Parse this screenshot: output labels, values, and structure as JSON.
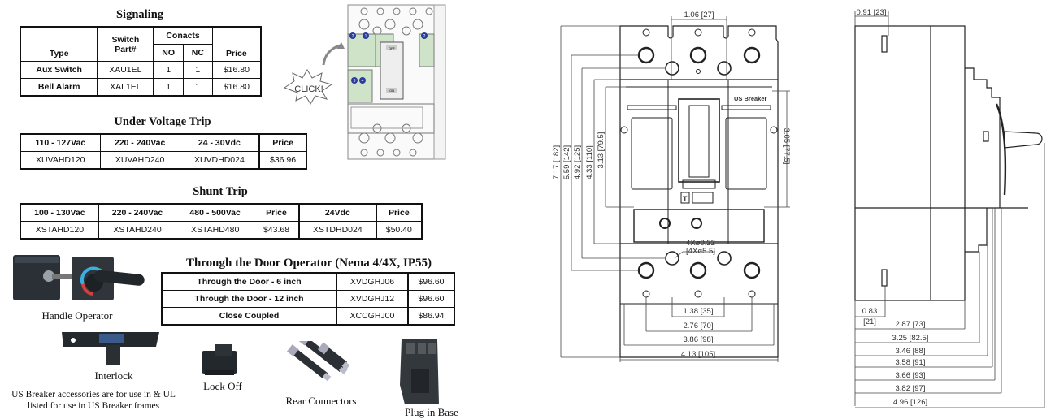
{
  "signaling": {
    "title": "Signaling",
    "headers": {
      "type": "Type",
      "switch_part": "Switch Part#",
      "contacts": "Conacts",
      "no": "NO",
      "nc": "NC",
      "price": "Price"
    },
    "rows": [
      {
        "type": "Aux Switch",
        "part": "XAU1EL",
        "no": "1",
        "nc": "1",
        "price": "$16.80"
      },
      {
        "type": "Bell Alarm",
        "part": "XAL1EL",
        "no": "1",
        "nc": "1",
        "price": "$16.80"
      }
    ]
  },
  "under_voltage": {
    "title": "Under Voltage Trip",
    "headers": [
      "110 - 127Vac",
      "220 - 240Vac",
      "24 - 30Vdc",
      "Price"
    ],
    "row": [
      "XUVAHD120",
      "XUVAHD240",
      "XUVDHD024",
      "$36.96"
    ]
  },
  "shunt_trip": {
    "title": "Shunt Trip",
    "headers": [
      "100 - 130Vac",
      "220 - 240Vac",
      "480 - 500Vac",
      "Price",
      "24Vdc",
      "Price"
    ],
    "row": [
      "XSTAHD120",
      "XSTAHD240",
      "XSTAHD480",
      "$43.68",
      "XSTDHD024",
      "$50.40"
    ]
  },
  "door_operator": {
    "title": "Through the Door Operator (Nema 4/4X, IP55)",
    "rows": [
      [
        "Through the Door - 6 inch",
        "XVDGHJ06",
        "$96.60"
      ],
      [
        "Through the Door - 12 inch",
        "XVDGHJ12",
        "$96.60"
      ],
      [
        "Close Coupled",
        "XCCGHJ00",
        "$86.94"
      ]
    ]
  },
  "accessories": {
    "handle_operator": "Handle Operator",
    "interlock": "Interlock",
    "lock_off": "Lock Off",
    "rear_connectors": "Rear Connectors",
    "plug_in_base": "Plug in Base",
    "note_line1": "US Breaker accessories are for use in & UL",
    "note_line2": "listed for use in US Breaker frames"
  },
  "install_diagram": {
    "click_label": "CLICK!",
    "badges": [
      "2",
      "1",
      "2",
      "3",
      "4"
    ],
    "off_label": "OFF",
    "on_label": "ON"
  },
  "front_view": {
    "brand_label": "US Breaker",
    "t_label": "T",
    "top_dim": "1.06 [27]",
    "left_dims": [
      "7.17 [182]",
      "5.59 [142]",
      "4.92 [125]",
      "4.33 [110]",
      "3.13 [79.5]"
    ],
    "right_dim": "3.05 [77.5]",
    "hole_dim_1": "4Xø0.22",
    "hole_dim_2": "[4Xø5.5]",
    "bottom_dims": [
      "1.38 [35]",
      "2.76 [70]",
      "3.86 [98]",
      "4.13 [105]"
    ]
  },
  "side_view": {
    "top_dim": "0.91 [23]",
    "small_dim_1": "0.83",
    "small_dim_2": "[21]",
    "bottom_dims": [
      "2.87 [73]",
      "3.25 [82.5]",
      "3.46 [88]",
      "3.58 [91]",
      "3.66 [93]",
      "3.82 [97]",
      "4.96 [126]"
    ]
  }
}
